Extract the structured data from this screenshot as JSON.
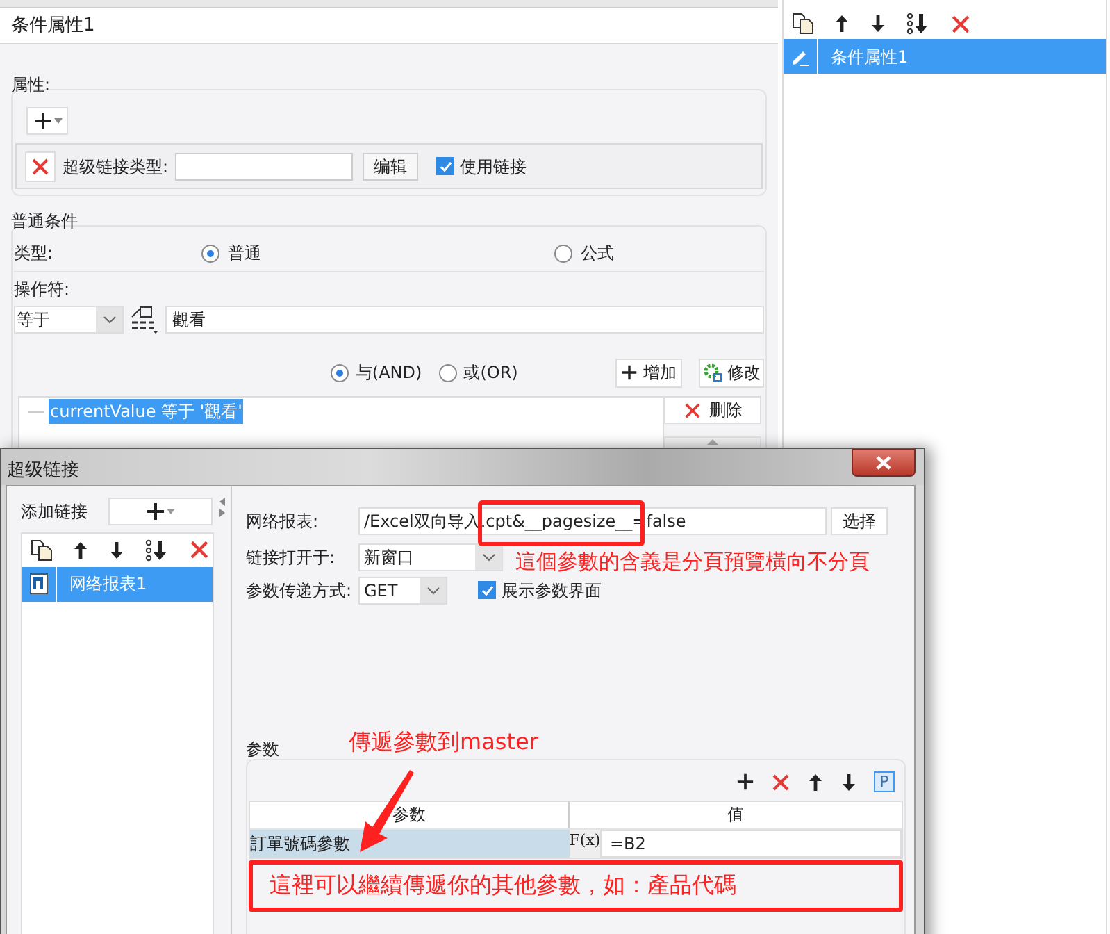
{
  "panel": {
    "title": "条件属性1",
    "properties": {
      "legend": "属性:",
      "type_label": "超级链接类型:",
      "edit_button": "编辑",
      "use_link": {
        "label": "使用链接",
        "checked": true
      }
    },
    "condition": {
      "legend": "普通条件",
      "type_label": "类型:",
      "type_options": [
        {
          "label": "普通",
          "selected": true
        },
        {
          "label": "公式",
          "selected": false
        }
      ],
      "operator_label": "操作符:",
      "operator": "等于",
      "value": "觀看",
      "logic_options": [
        {
          "label": "与(AND)",
          "selected": true
        },
        {
          "label": "或(OR)",
          "selected": false
        }
      ],
      "add_button": "增加",
      "modify_button": "修改",
      "conditions": [
        {
          "text": "currentValue 等于 '觀看'",
          "selected": true
        }
      ],
      "delete_button": "删除"
    }
  },
  "side_list": {
    "items": [
      {
        "label": "条件属性1",
        "selected": true
      }
    ]
  },
  "dialog": {
    "title": "超级链接",
    "add_link_label": "添加链接",
    "links": [
      {
        "label": "网络报表1",
        "selected": true
      }
    ],
    "report_label": "网络报表:",
    "report_value": "/Excel双向导入.cpt&__pagesize__=false",
    "choose_button": "选择",
    "open_in_label": "链接打开于:",
    "open_in": "新窗口",
    "method_label": "参数传递方式:",
    "method": "GET",
    "show_params": {
      "label": "展示参数界面",
      "checked": true
    },
    "params": {
      "legend": "参数",
      "parameter_button": "P",
      "formula_label": "F(x)",
      "columns": [
        "参数",
        "值"
      ],
      "rows": [
        {
          "name": "訂單號碼參數",
          "value": "=B2",
          "selected": true
        }
      ]
    }
  },
  "annotations": {
    "url_note": "這個參數的含義是分頁預覽橫向不分頁",
    "arrow_note": "傳遞參數到master",
    "row_note": "這裡可以繼續傳遞你的其他參數，如：產品代碼"
  }
}
